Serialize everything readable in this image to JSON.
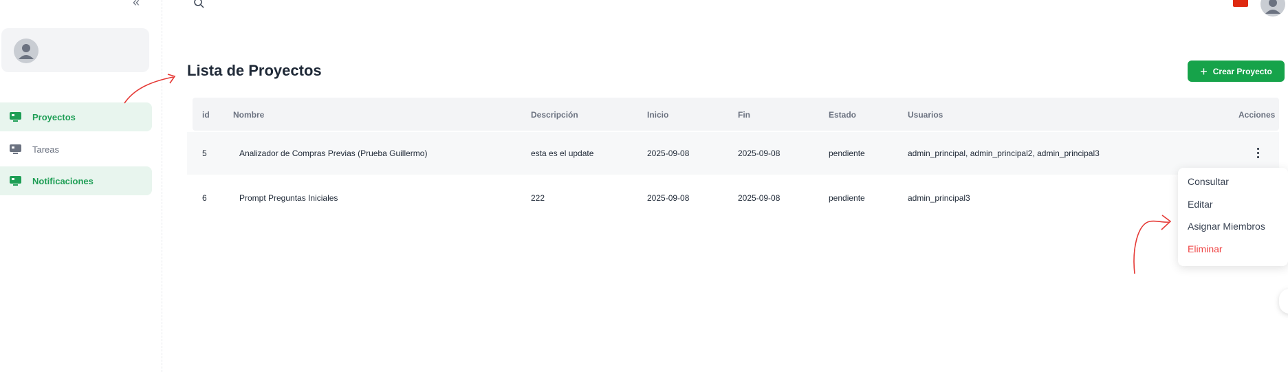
{
  "sidebar": {
    "items": [
      {
        "label": "Proyectos",
        "icon": "monitor-icon",
        "active": true
      },
      {
        "label": "Tareas",
        "icon": "monitor-icon",
        "active": false
      },
      {
        "label": "Notificaciones",
        "icon": "monitor-icon",
        "active": true
      }
    ]
  },
  "header": {
    "search_icon": "search-icon",
    "flag_icon": "china-flag-icon",
    "avatar_icon": "user-avatar-icon"
  },
  "page": {
    "title": "Lista de Proyectos",
    "create_button": "Crear Proyecto"
  },
  "table": {
    "columns": [
      "id",
      "Nombre",
      "Descripción",
      "Inicio",
      "Fin",
      "Estado",
      "Usuarios",
      "Acciones"
    ],
    "rows": [
      {
        "id": "5",
        "nombre": "Analizador de Compras Previas (Prueba Guillermo)",
        "descripcion": "esta es el update",
        "inicio": "2025-09-08",
        "fin": "2025-09-08",
        "estado": "pendiente",
        "usuarios": "admin_principal, admin_principal2, admin_principal3"
      },
      {
        "id": "6",
        "nombre": "Prompt Preguntas Iniciales",
        "descripcion": "222",
        "inicio": "2025-09-08",
        "fin": "2025-09-08",
        "estado": "pendiente",
        "usuarios": "admin_principal3"
      }
    ]
  },
  "action_menu": {
    "items": [
      "Consultar",
      "Editar",
      "Asignar Miembros",
      "Eliminar"
    ]
  },
  "colors": {
    "accent": "#16a34a",
    "active_bg": "#e8f5ee",
    "danger": "#ef4444",
    "annotation": "#e53935"
  }
}
